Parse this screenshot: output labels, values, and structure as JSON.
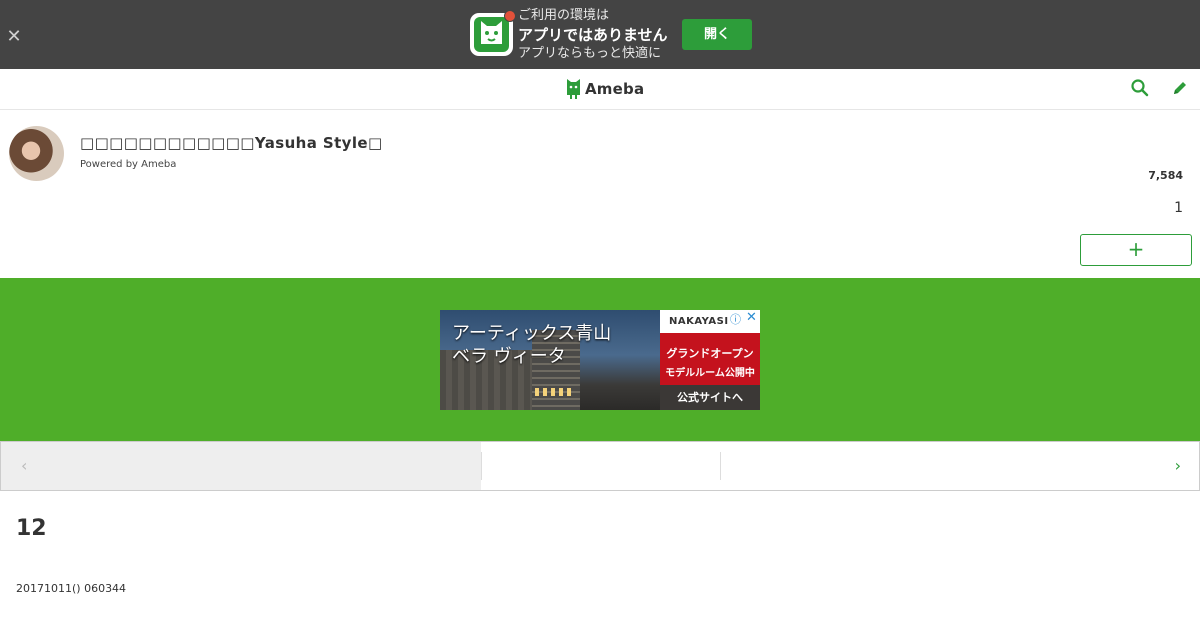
{
  "app_banner": {
    "close_icon": "close-icon",
    "logo_icon": "ameba-app-icon",
    "line1": "ご利用の環境は",
    "line2": "アプリではありません",
    "line3": "アプリならもっと快適に",
    "open_label": "開く",
    "colors": {
      "background": "#444444",
      "button": "#2d9d3a",
      "badge": "#e2513a"
    }
  },
  "header": {
    "logo_text": "Ameba",
    "search_icon": "search-icon",
    "edit_icon": "pencil-icon"
  },
  "profile": {
    "blog_title": "□□□□□□□□□□□□Yasuha Style□",
    "powered_by": "Powered by Ameba",
    "readers_count": "7,584",
    "secondary_count": "1",
    "follow_label": "+"
  },
  "ad": {
    "headline1": "アーティックス青山",
    "headline2": "ベラ ヴィータ",
    "brand": "NAKAYASI",
    "info_icon": "ⓘ",
    "close_icon": "✕",
    "badge_line1": "グランドオープン",
    "badge_line2": "モデルルーム公開中",
    "cta": "公式サイトへ",
    "colors": {
      "section_background": "#4fae29",
      "badge": "#c4121d"
    }
  },
  "pager": {
    "prev_icon": "‹",
    "next_icon": "›"
  },
  "article": {
    "title": "12",
    "date": "20171011() 060344"
  }
}
